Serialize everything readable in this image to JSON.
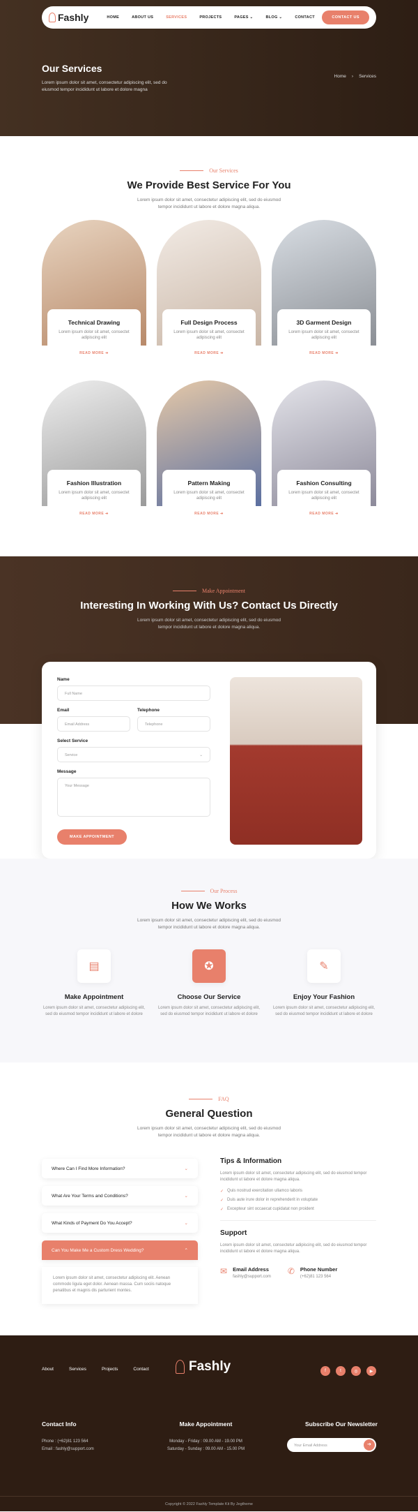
{
  "nav": {
    "brand": "Fashly",
    "links": [
      "HOME",
      "ABOUT US",
      "SERVICES",
      "PROJECTS",
      "PAGES",
      "BLOG",
      "CONTACT"
    ],
    "cta": "CONTACT US"
  },
  "hero": {
    "title": "Our Services",
    "desc": "Lorem ipsum dolor sit amet, consectetur adipiscing elit, sed do eiusmod tempor incididunt ut labore et dolore magna",
    "crumb_home": "Home",
    "crumb_current": "Services"
  },
  "services": {
    "sub": "Our Services",
    "title": "We Provide Best Service For You",
    "lead": "Lorem ipsum dolor sit amet, consectetur adipiscing elit, sed do eiusmod tempor incididunt ut labore et dolore magna aliqua.",
    "read_more": "READ MORE",
    "items": [
      {
        "title": "Technical Drawing",
        "desc": "Lorem ipsum dolor sit amet, consectet adipiscing elit"
      },
      {
        "title": "Full Design Process",
        "desc": "Lorem ipsum dolor sit amet, consectet adipiscing elit"
      },
      {
        "title": "3D Garment Design",
        "desc": "Lorem ipsum dolor sit amet, consectet adipiscing elit"
      },
      {
        "title": "Fashion Illustration",
        "desc": "Lorem ipsum dolor sit amet, consectet adipiscing elit"
      },
      {
        "title": "Pattern Making",
        "desc": "Lorem ipsum dolor sit amet, consectet adipiscing elit"
      },
      {
        "title": "Fashion Consulting",
        "desc": "Lorem ipsum dolor sit amet, consectet adipiscing elit"
      }
    ]
  },
  "appointment": {
    "sub": "Make Appointment",
    "title": "Interesting In Working With Us? Contact Us Directly",
    "lead": "Lorem ipsum dolor sit amet, consectetur adipiscing elit, sed do eiusmod tempor incididunt ut labore et dolore magna aliqua.",
    "name_label": "Name",
    "name_ph": "Full Name",
    "email_label": "Email",
    "email_ph": "Email Address",
    "tel_label": "Telephone",
    "tel_ph": "Telephone",
    "service_label": "Select Service",
    "service_value": "Service",
    "message_label": "Message",
    "message_ph": "Your Message",
    "button": "MAKE APPOINTMENT"
  },
  "process": {
    "sub": "Our Process",
    "title": "How We Works",
    "lead": "Lorem ipsum dolor sit amet, consectetur adipiscing elit, sed do eiusmod tempor incididunt ut labore et dolore magna aliqua.",
    "steps": [
      {
        "title": "Make Appointment",
        "desc": "Lorem ipsum dolor sit amet, consectetur adipiscing elit, sed do eiusmod tempor incididunt ut labore et dolore"
      },
      {
        "title": "Choose Our Service",
        "desc": "Lorem ipsum dolor sit amet, consectetur adipiscing elit, sed do eiusmod tempor incididunt ut labore et dolore"
      },
      {
        "title": "Enjoy Your Fashion",
        "desc": "Lorem ipsum dolor sit amet, consectetur adipiscing elit, sed do eiusmod tempor incididunt ut labore et dolore"
      }
    ]
  },
  "faq": {
    "sub": "FAQ",
    "title": "General Question",
    "lead": "Lorem ipsum dolor sit amet, consectetur adipiscing elit, sed do eiusmod tempor incididunt ut labore et dolore magna aliqua.",
    "questions": [
      "Where Can I Find More Information?",
      "What Are Your Terms and Conditions?",
      "What Kinds of Payment Do You Accept?",
      "Can You Make Me a Custom Dress Wedding?"
    ],
    "answer": "Lorem ipsum dolor sit amet, consectetur adipiscing elit. Aenean commodo ligula eget dolor. Aenean massa. Cum sociis natoque penatibus et magnis dis parturient montes.",
    "tips_title": "Tips & Information",
    "tips_desc": "Lorem ipsum dolor sit amet, consectetur adipiscing elit, sed do eiusmod tempor incididunt ut labore et dolore magna aliqua.",
    "tips": [
      "Quis nostrud exercitation ullamco laboris",
      "Duis aute irure dolor in reprehenderit in voluptate",
      "Excepteur sint occaecat cupidatat non proident"
    ],
    "support_title": "Support",
    "support_desc": "Lorem ipsum dolor sit amet, consectetur adipiscing elit, sed do eiusmod tempor incididunt ut labore et dolore magna aliqua.",
    "email_title": "Email Address",
    "email_value": "fashly@support.com",
    "phone_title": "Phone Number",
    "phone_value": "(+62)81 123 564"
  },
  "footer": {
    "links": [
      "About",
      "Services",
      "Projects",
      "Contact"
    ],
    "brand": "Fashly",
    "contact_title": "Contact Info",
    "contact_phone": "Phone : (+62)81 123 564",
    "contact_email": "Email : fashly@support.com",
    "appt_title": "Make Appointment",
    "appt_line1": "Monday - Friday : 09.00 AM - 19.00 PM",
    "appt_line2": "Saturday - Sunday : 09.00 AM - 15.00 PM",
    "news_title": "Subscribe Our Newsletter",
    "news_ph": "Your Email Address",
    "copyright": "Copyright © 2022 Fashly Template Kit By Jegtheme"
  },
  "colors": {
    "accent": "#e8806b",
    "dark": "#2e1d13"
  }
}
